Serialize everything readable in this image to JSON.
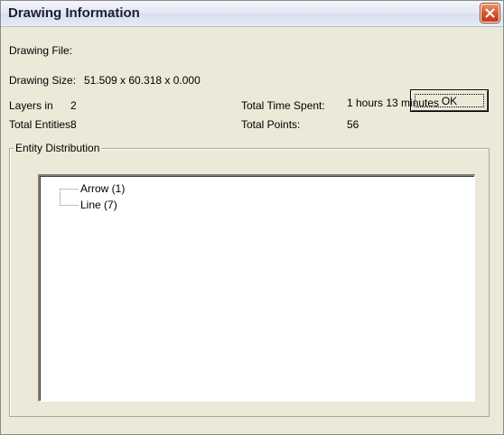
{
  "window": {
    "title": "Drawing Information"
  },
  "info": {
    "drawing_file_label": "Drawing File:",
    "drawing_size_label": "Drawing Size:",
    "drawing_size_value": "51.509 x 60.318 x 0.000",
    "layers_label": "Layers in",
    "layers_value": "2",
    "total_entities_label": "Total Entities:",
    "total_entities_value": "8",
    "total_time_label": "Total Time Spent:",
    "total_time_value": "1 hours 13 minutes",
    "total_points_label": "Total Points:",
    "total_points_value": "56"
  },
  "buttons": {
    "ok_label": "OK"
  },
  "entity_distribution": {
    "title": "Entity Distribution",
    "items": [
      {
        "label": "Arrow  (1)"
      },
      {
        "label": "Line  (7)"
      }
    ]
  },
  "icons": {
    "close": "close-icon"
  },
  "colors": {
    "close_button": "#d4572f",
    "dialog_background": "#ece9d8",
    "title_text": "#1a2030"
  }
}
